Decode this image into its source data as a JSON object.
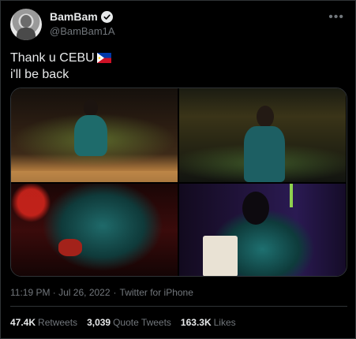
{
  "author": {
    "display_name": "BamBam",
    "handle": "@BamBam1A"
  },
  "tweet": {
    "line1": "Thank u CEBU",
    "line2": "i'll be back"
  },
  "meta": {
    "time": "11:19 PM · Jul 26, 2022",
    "separator": "·",
    "source": "Twitter for iPhone"
  },
  "stats": {
    "retweets_count": "47.4K",
    "retweets_label": "Retweets",
    "quotes_count": "3,039",
    "quotes_label": "Quote Tweets",
    "likes_count": "163.3K",
    "likes_label": "Likes"
  },
  "icons": {
    "verified": "verified-badge-icon",
    "flag": "philippines-flag-icon",
    "more": "more-options-icon"
  },
  "colors": {
    "background": "#000000",
    "primary_text": "#e7e9ea",
    "secondary_text": "#71767b",
    "border": "#2f3336"
  }
}
